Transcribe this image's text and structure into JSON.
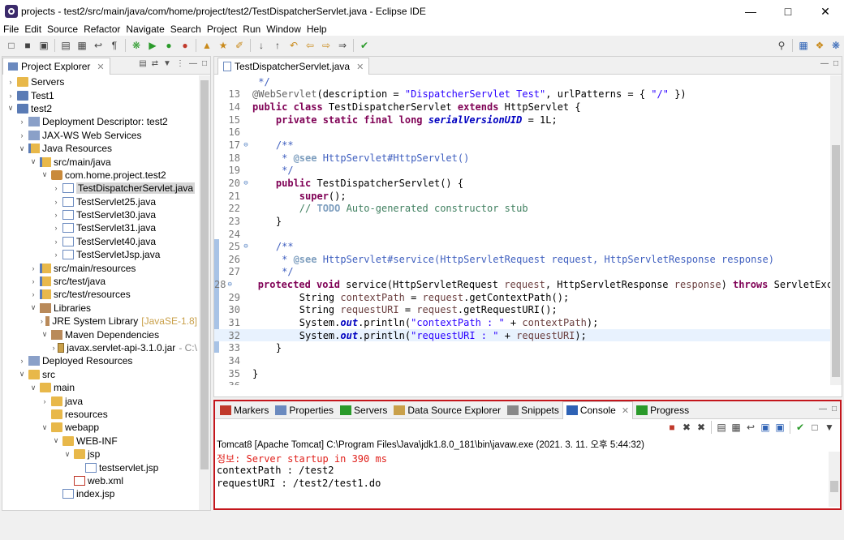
{
  "window": {
    "title": "projects - test2/src/main/java/com/home/project/test2/TestDispatcherServlet.java - Eclipse IDE"
  },
  "menu": [
    "File",
    "Edit",
    "Source",
    "Refactor",
    "Navigate",
    "Search",
    "Project",
    "Run",
    "Window",
    "Help"
  ],
  "explorer": {
    "tab_label": "Project Explorer",
    "tree": [
      {
        "depth": 0,
        "arrow": "collapsed",
        "icon": "folder",
        "label": "Servers"
      },
      {
        "depth": 0,
        "arrow": "collapsed",
        "icon": "proj",
        "label": "Test1"
      },
      {
        "depth": 0,
        "arrow": "expanded",
        "icon": "proj",
        "label": "test2"
      },
      {
        "depth": 1,
        "arrow": "collapsed",
        "icon": "srv",
        "label": "Deployment Descriptor: test2"
      },
      {
        "depth": 1,
        "arrow": "collapsed",
        "icon": "srv",
        "label": "JAX-WS Web Services"
      },
      {
        "depth": 1,
        "arrow": "expanded",
        "icon": "jfolder",
        "label": "Java Resources"
      },
      {
        "depth": 2,
        "arrow": "expanded",
        "icon": "jfolder",
        "label": "src/main/java"
      },
      {
        "depth": 3,
        "arrow": "expanded",
        "icon": "pkg",
        "label": "com.home.project.test2"
      },
      {
        "depth": 4,
        "arrow": "collapsed",
        "icon": "java",
        "label": "TestDispatcherServlet.java",
        "selected": true
      },
      {
        "depth": 4,
        "arrow": "collapsed",
        "icon": "java",
        "label": "TestServlet25.java"
      },
      {
        "depth": 4,
        "arrow": "collapsed",
        "icon": "java",
        "label": "TestServlet30.java"
      },
      {
        "depth": 4,
        "arrow": "collapsed",
        "icon": "java",
        "label": "TestServlet31.java"
      },
      {
        "depth": 4,
        "arrow": "collapsed",
        "icon": "java",
        "label": "TestServlet40.java"
      },
      {
        "depth": 4,
        "arrow": "collapsed",
        "icon": "java",
        "label": "TestServletJsp.java"
      },
      {
        "depth": 2,
        "arrow": "collapsed",
        "icon": "jfolder",
        "label": "src/main/resources"
      },
      {
        "depth": 2,
        "arrow": "collapsed",
        "icon": "jfolder",
        "label": "src/test/java"
      },
      {
        "depth": 2,
        "arrow": "collapsed",
        "icon": "jfolder",
        "label": "src/test/resources"
      },
      {
        "depth": 2,
        "arrow": "expanded",
        "icon": "lib",
        "label": "Libraries"
      },
      {
        "depth": 3,
        "arrow": "collapsed",
        "icon": "lib",
        "label": "JRE System Library",
        "badge": "[JavaSE-1.8]"
      },
      {
        "depth": 3,
        "arrow": "expanded",
        "icon": "lib",
        "label": "Maven Dependencies"
      },
      {
        "depth": 4,
        "arrow": "collapsed",
        "icon": "jar",
        "label": "javax.servlet-api-3.1.0.jar",
        "gray": "- C:\\"
      },
      {
        "depth": 1,
        "arrow": "collapsed",
        "icon": "srv",
        "label": "Deployed Resources"
      },
      {
        "depth": 1,
        "arrow": "expanded",
        "icon": "folder",
        "label": "src"
      },
      {
        "depth": 2,
        "arrow": "expanded",
        "icon": "folder",
        "label": "main"
      },
      {
        "depth": 3,
        "arrow": "collapsed",
        "icon": "folder",
        "label": "java"
      },
      {
        "depth": 3,
        "arrow": "none",
        "icon": "folder",
        "label": "resources"
      },
      {
        "depth": 3,
        "arrow": "expanded",
        "icon": "folder",
        "label": "webapp"
      },
      {
        "depth": 4,
        "arrow": "expanded",
        "icon": "folder",
        "label": "WEB-INF"
      },
      {
        "depth": 5,
        "arrow": "expanded",
        "icon": "folder",
        "label": "jsp"
      },
      {
        "depth": 6,
        "arrow": "none",
        "icon": "java",
        "label": "testservlet.jsp"
      },
      {
        "depth": 5,
        "arrow": "none",
        "icon": "xml",
        "label": "web.xml"
      },
      {
        "depth": 4,
        "arrow": "none",
        "icon": "java",
        "label": "index.jsp"
      }
    ]
  },
  "editor": {
    "tab_label": "TestDispatcherServlet.java",
    "lines": [
      {
        "n": "",
        "fold": "",
        "html": "<span class='cm'> */</span>"
      },
      {
        "n": "13",
        "fold": "",
        "html": "<span class='an'>@WebServlet</span>(description = <span class='str'>\"DispatcherServlet Test\"</span>, urlPatterns = { <span class='str'>\"/\"</span> })"
      },
      {
        "n": "14",
        "fold": "",
        "html": "<span class='kw'>public class</span> TestDispatcherServlet <span class='kw'>extends</span> HttpServlet {"
      },
      {
        "n": "15",
        "fold": "",
        "html": "    <span class='kw'>private static final long</span> <span class='fld'><b>serialVersionUID</b></span> = 1L;"
      },
      {
        "n": "16",
        "fold": "",
        "html": ""
      },
      {
        "n": "17",
        "fold": "⊖",
        "html": "    <span class='cm'>/**</span>"
      },
      {
        "n": "18",
        "fold": "",
        "html": "<span class='cm'>     * </span><span class='doc-k'>@see</span><span class='cm'> HttpServlet#HttpServlet()</span>"
      },
      {
        "n": "19",
        "fold": "",
        "html": "<span class='cm'>     */</span>"
      },
      {
        "n": "20",
        "fold": "⊖",
        "html": "    <span class='kw'>public</span> TestDispatcherServlet() {"
      },
      {
        "n": "21",
        "fold": "",
        "html": "        <span class='kw'>super</span>();"
      },
      {
        "n": "22",
        "fold": "",
        "html": "        <span class='sl'>// </span><span class='todo'>TODO</span><span class='sl'> Auto-generated constructor stub</span>"
      },
      {
        "n": "23",
        "fold": "",
        "html": "    }"
      },
      {
        "n": "24",
        "fold": "",
        "html": ""
      },
      {
        "n": "25",
        "fold": "⊖",
        "html": "    <span class='cm'>/**</span>"
      },
      {
        "n": "26",
        "fold": "",
        "html": "<span class='cm'>     * </span><span class='doc-k'>@see</span><span class='cm'> HttpServlet#service(HttpServletRequest request, HttpServletResponse response)</span>"
      },
      {
        "n": "27",
        "fold": "",
        "html": "<span class='cm'>     */</span>"
      },
      {
        "n": "28",
        "fold": "⊖",
        "html": "    <span class='kw'>protected void</span> service(HttpServletRequest <span class='par'>request</span>, HttpServletResponse <span class='par'>response</span>) <span class='kw'>throws</span> ServletExcep"
      },
      {
        "n": "29",
        "fold": "",
        "html": "        String <span class='var'>contextPath</span> = <span class='par'>request</span>.getContextPath();"
      },
      {
        "n": "30",
        "fold": "",
        "html": "        String <span class='var'>requestURI</span> = <span class='par'>request</span>.getRequestURI();"
      },
      {
        "n": "31",
        "fold": "",
        "html": "        System.<span class='fld'><b>out</b></span>.println(<span class='str'>\"contextPath : \"</span> + <span class='var'>contextPath</span>);"
      },
      {
        "n": "32",
        "fold": "",
        "html": "        System.<span class='fld'><b>out</b></span>.println(<span class='str'>\"requestURI : \"</span> + <span class='var'>requestURI</span>);",
        "hl": true
      },
      {
        "n": "33",
        "fold": "",
        "html": "    }"
      },
      {
        "n": "34",
        "fold": "",
        "html": ""
      },
      {
        "n": "35",
        "fold": "",
        "html": "}"
      },
      {
        "n": "36",
        "fold": "",
        "html": ""
      }
    ]
  },
  "console": {
    "tabs": [
      {
        "label": "Markers",
        "icon": "markers-icon"
      },
      {
        "label": "Properties",
        "icon": "properties-icon"
      },
      {
        "label": "Servers",
        "icon": "servers-icon"
      },
      {
        "label": "Data Source Explorer",
        "icon": "datasource-icon"
      },
      {
        "label": "Snippets",
        "icon": "snippets-icon"
      },
      {
        "label": "Console",
        "icon": "console-icon",
        "active": true
      },
      {
        "label": "Progress",
        "icon": "progress-icon"
      }
    ],
    "process": "Tomcat8 [Apache Tomcat] C:\\Program Files\\Java\\jdk1.8.0_181\\bin\\javaw.exe  (2021. 3. 11. 오후 5:44:32)",
    "output": [
      {
        "text": "정보: Server startup in 390 ms",
        "style": "err"
      },
      {
        "text": "contextPath : /test2",
        "style": ""
      },
      {
        "text": "requestURI : /test2/test1.do",
        "style": ""
      }
    ],
    "highlight_color": "#c4161c"
  }
}
